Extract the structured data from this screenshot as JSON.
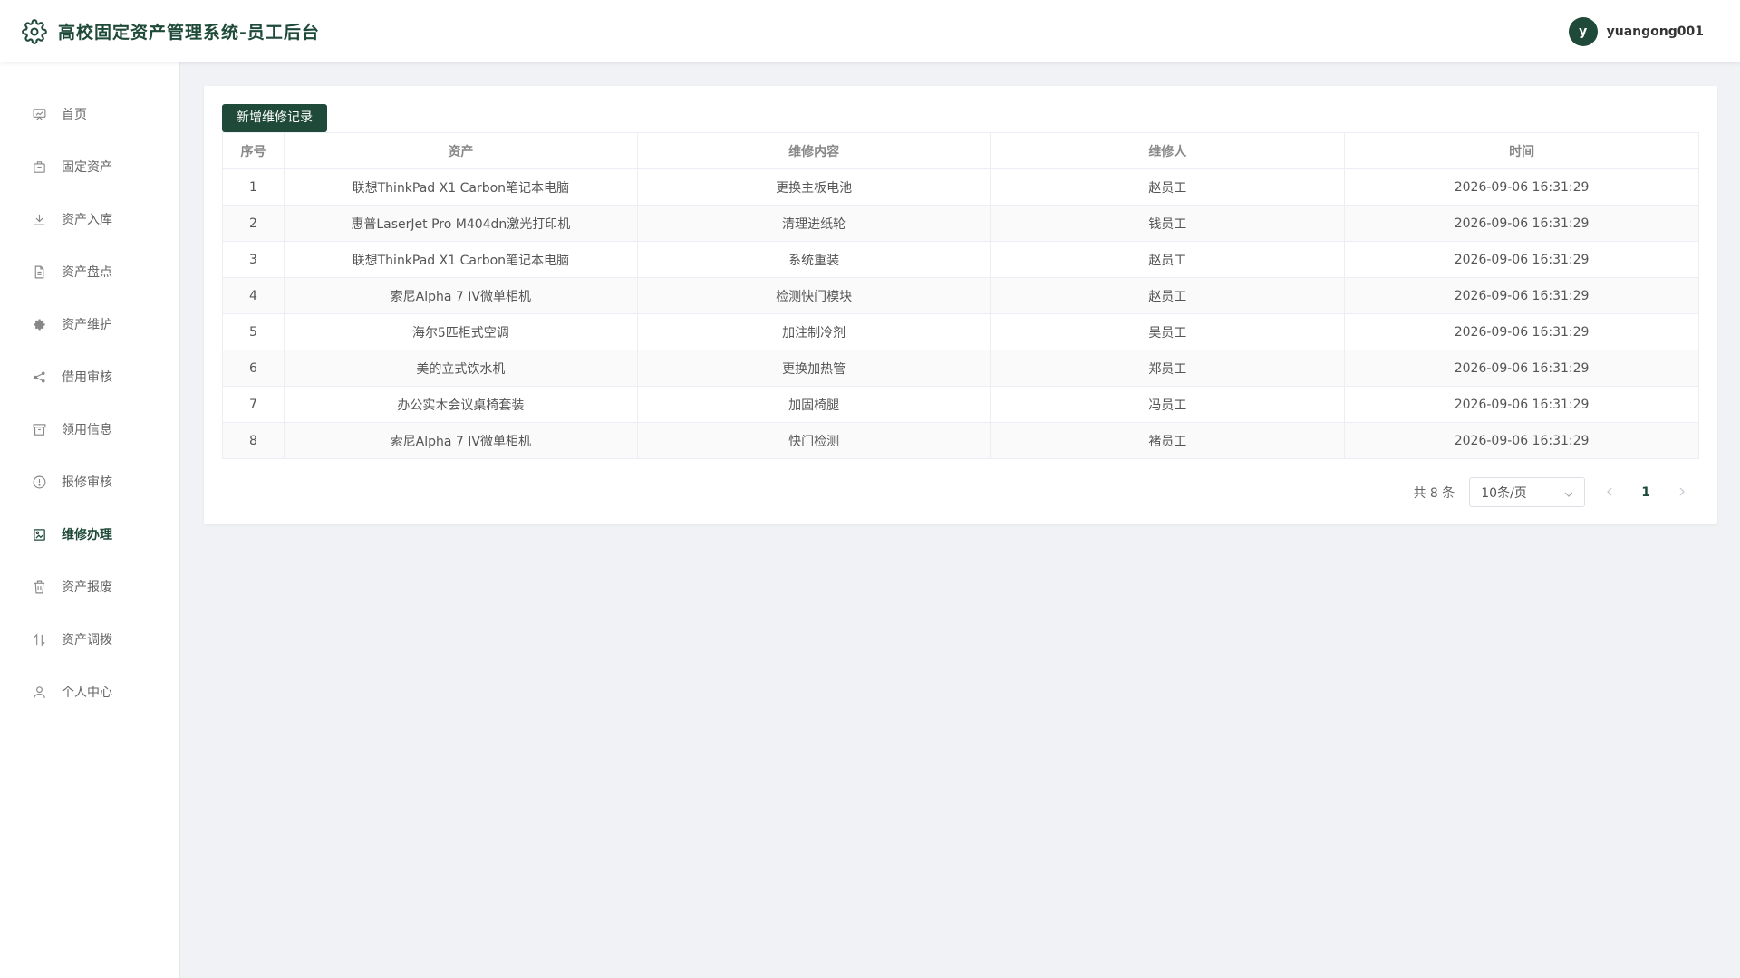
{
  "header": {
    "title": "高校固定资产管理系统-员工后台",
    "logo_icon": "gear-icon",
    "avatar_letter": "y",
    "username": "yuangong001"
  },
  "sidebar": {
    "items": [
      {
        "label": "首页",
        "icon": "dashboard-icon",
        "active": false
      },
      {
        "label": "固定资产",
        "icon": "box-icon",
        "active": false
      },
      {
        "label": "资产入库",
        "icon": "download-icon",
        "active": false
      },
      {
        "label": "资产盘点",
        "icon": "document-icon",
        "active": false
      },
      {
        "label": "资产维护",
        "icon": "settings-icon",
        "active": false
      },
      {
        "label": "借用审核",
        "icon": "share-icon",
        "active": false
      },
      {
        "label": "领用信息",
        "icon": "archive-icon",
        "active": false
      },
      {
        "label": "报修审核",
        "icon": "info-circle-icon",
        "active": false
      },
      {
        "label": "维修办理",
        "icon": "picture-icon",
        "active": true
      },
      {
        "label": "资产报废",
        "icon": "trash-icon",
        "active": false
      },
      {
        "label": "资产调拨",
        "icon": "transfer-icon",
        "active": false
      },
      {
        "label": "个人中心",
        "icon": "user-icon",
        "active": false
      }
    ]
  },
  "main": {
    "add_button_label": "新增维修记录",
    "table": {
      "headers": [
        "序号",
        "资产",
        "维修内容",
        "维修人",
        "时间"
      ],
      "rows": [
        [
          "1",
          "联想ThinkPad X1 Carbon笔记本电脑",
          "更换主板电池",
          "赵员工",
          "2026-09-06 16:31:29"
        ],
        [
          "2",
          "惠普LaserJet Pro M404dn激光打印机",
          "清理进纸轮",
          "钱员工",
          "2026-09-06 16:31:29"
        ],
        [
          "3",
          "联想ThinkPad X1 Carbon笔记本电脑",
          "系统重装",
          "赵员工",
          "2026-09-06 16:31:29"
        ],
        [
          "4",
          "索尼Alpha 7 IV微单相机",
          "检测快门模块",
          "赵员工",
          "2026-09-06 16:31:29"
        ],
        [
          "5",
          "海尔5匹柜式空调",
          "加注制冷剂",
          "吴员工",
          "2026-09-06 16:31:29"
        ],
        [
          "6",
          "美的立式饮水机",
          "更换加热管",
          "郑员工",
          "2026-09-06 16:31:29"
        ],
        [
          "7",
          "办公实木会议桌椅套装",
          "加固椅腿",
          "冯员工",
          "2026-09-06 16:31:29"
        ],
        [
          "8",
          "索尼Alpha 7 IV微单相机",
          "快门检测",
          "褚员工",
          "2026-09-06 16:31:29"
        ]
      ]
    },
    "pagination": {
      "total_text": "共 8 条",
      "page_size": "10条/页",
      "current_page": "1"
    }
  }
}
